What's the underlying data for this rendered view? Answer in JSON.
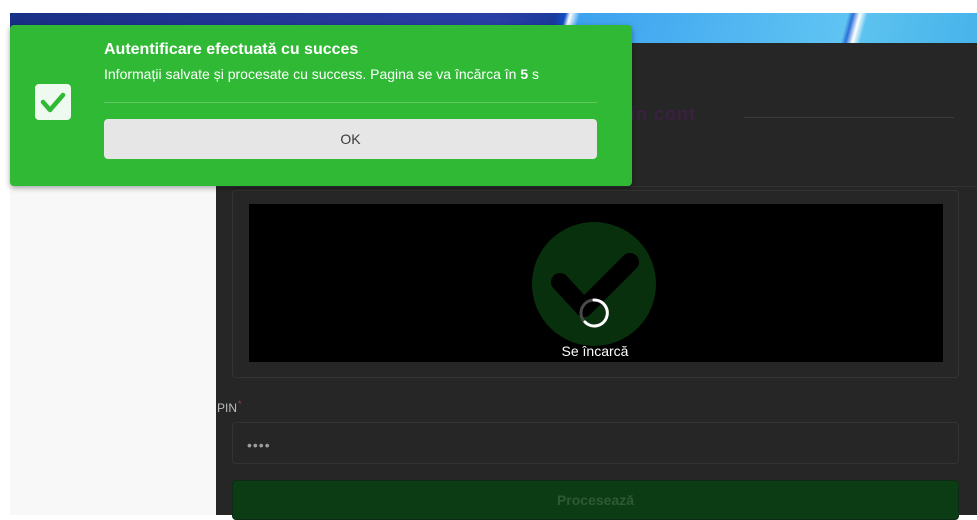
{
  "form": {
    "title": "în cont",
    "loading_text": "Se încarcă",
    "pin_label": "PIN",
    "pin_required": "*",
    "pin_value": "••••",
    "process_label": "Procesează"
  },
  "toast": {
    "title": "Autentificare efectuată cu succes",
    "message_prefix": "Informații salvate și procesate cu success. Pagina se va încărca în",
    "countdown": "5",
    "message_suffix": "s",
    "ok_label": "OK"
  },
  "colors": {
    "toast_bg": "#30b935",
    "overlay_bg": "#262626",
    "process_btn_bg": "#0c3c14"
  },
  "icons": {
    "toast": "checkbox-check-icon",
    "camera": "check-icon",
    "loading": "spinner-icon"
  }
}
